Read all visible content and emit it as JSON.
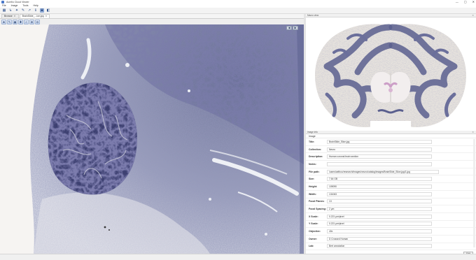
{
  "window": {
    "title": "Aurelio Cloud Viewer",
    "controls": [
      "—",
      "▢",
      "✕"
    ]
  },
  "menu": [
    "File",
    "Image",
    "Tools",
    "Help"
  ],
  "toolbar": {
    "icons": [
      "grid-icon",
      "open-icon",
      "tool-icon",
      "pen-icon",
      "annotate-icon",
      "info-icon",
      "window-icon",
      "view-icon"
    ],
    "glyphs": [
      "▦",
      "↳",
      "✦",
      "✎",
      "↗",
      "ℹ",
      "▣",
      "◧"
    ]
  },
  "tabs": [
    {
      "label": "Browse"
    },
    {
      "label": "BrainSlide_...ice.jpg"
    }
  ],
  "viewer_tools": {
    "glyphs": [
      "★",
      "✎",
      "◉",
      "✚",
      "⌕",
      "⊕",
      "⊖"
    ]
  },
  "nav_arrows": [
    "◀",
    "▶"
  ],
  "overview": {
    "title": "Macro view"
  },
  "info": {
    "panel_title": "Image info",
    "section": "Image",
    "rows": [
      {
        "label": "Title:",
        "value": "BrainSlide_Slice.jpg"
      },
      {
        "label": "Collection:",
        "value": "Neuro"
      },
      {
        "label": "Description:",
        "value": "Human coronal brain section"
      },
      {
        "label": "Notes:",
        "value": ""
      },
      {
        "label": "File path:",
        "value": "/users/aelbou/research/images/neuro/catalog/images/BrainSlide_Slice.jpg/1.jpg"
      },
      {
        "label": "Size:",
        "value": "7.64 GB"
      },
      {
        "label": "Height:",
        "value": "109090"
      },
      {
        "label": "Width:",
        "value": "131063"
      },
      {
        "label": "Focal Planes:",
        "value": "13"
      },
      {
        "label": "Focal Spacing:",
        "value": "2 µm"
      },
      {
        "label": "X Scale:",
        "value": "0.221 µm/pixel"
      },
      {
        "label": "Y Scale:",
        "value": "0.221 µm/pixel"
      },
      {
        "label": "Objective:",
        "value": "40x"
      },
      {
        "label": "Owner:",
        "value": "D Crossed Human"
      },
      {
        "label": "Lab:",
        "value": "Bert annotation"
      }
    ],
    "edit_label": "Edit"
  },
  "colors": {
    "stain": "#5a5f8e",
    "tissue": "#d8dae4",
    "accent": "#2d4f8a"
  }
}
